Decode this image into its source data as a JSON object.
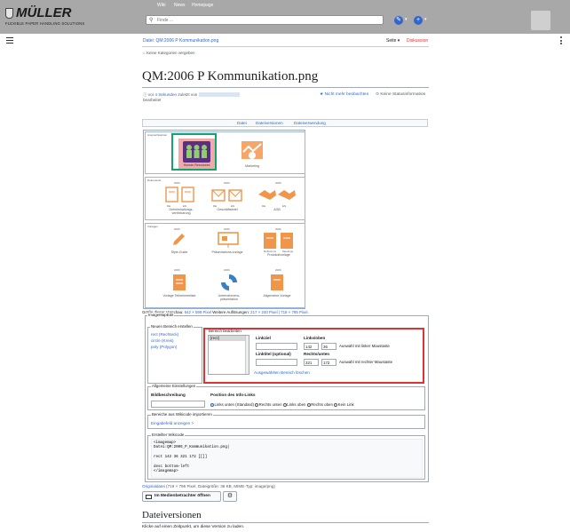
{
  "header": {
    "logo_text": "MÜLLER",
    "logo_sub": "FLEXIBLE PAPER HANDLING SOLUTIONS",
    "nav": [
      "Wiki",
      "News",
      "Homepage"
    ],
    "search_placeholder": "Finde ..."
  },
  "breadcrumb": "Datei: QM:2006 P Kommunikation.png",
  "page_tools": {
    "seite": "Seite ▾",
    "diskussion": "Diskussion"
  },
  "categories": "Keine Kategorien vergeben",
  "title": "QM:2006 P Kommunikation.png",
  "meta": {
    "edited_link": "vor 4 Sekunden",
    "edited_by": "zuletzt von",
    "edited_suffix": "bearbeitet",
    "watch": "Nicht mehr beobachten",
    "status": "Keine Statusinformation"
  },
  "file_tabs": [
    "Datei",
    "Dateiversionen",
    "Dateiverwendung"
  ],
  "map": {
    "groups": [
      {
        "label": "Ansprechpartner"
      },
      {
        "label": "Dokumente"
      },
      {
        "label": "Vorlagen"
      }
    ],
    "items": {
      "hr": "Human Resources",
      "marketing": "Marketing",
      "geheim": "Geheimhaltungs-vereinbarung",
      "brief": "Geschäftsbrief",
      "agb": "AGB",
      "style": "Style-Guide",
      "praes": "Präsentations-vorlage",
      "proto": "Protokollvorlage",
      "teil": "Vorlage Teilnehmerliste",
      "unter": "Unternehmens-präsentation",
      "allg": "Allgemeine Vorlage"
    },
    "years": [
      "2006",
      "2006",
      "2006",
      "2006",
      "2006",
      "2006",
      "2006",
      "2006"
    ],
    "sub_labels": [
      "DE",
      "EN",
      "DE",
      "EN",
      "DE",
      "EN",
      "Reflexions",
      "Meetings"
    ]
  },
  "preview_note": {
    "prefix": "Größe dieser Vorschau:",
    "size": "642 × 599 Pixel",
    "more": "Weitere Auflösungen:",
    "res": "217 × 240 Pixel | 719 × 795 Pixel."
  },
  "imagemap": {
    "legend": "ImageMapEdit",
    "new_area": {
      "legend": "Neuen Bereich erstellen",
      "options": [
        "rect (Rechteck)",
        "circle (Kreis)",
        "poly (Polygon)"
      ]
    },
    "edit_area": {
      "legend": "Bereich bearbeiten",
      "list_item": "[rect]",
      "linkziel": "Linkziel",
      "linktitel": "Linktitel (optional)",
      "links_oben": "Links/oben",
      "rechts_unten": "Rechts/unten",
      "lo_x": "142",
      "lo_y": "36",
      "ru_x": "321",
      "ru_y": "172",
      "hint_left": "Auswahl mit linker Maustaste",
      "hint_right": "Auswahl mit rechter Maustaste",
      "delete": "Ausgewählten Bereich löschen"
    },
    "general": {
      "legend": "Allgemeine Einstellungen",
      "bildbeschreibung": "Bildbeschreibung",
      "position": "Position des Info-Links",
      "radios": [
        "Links unten (Standard)",
        "Rechts unten",
        "Links oben",
        "Rechts oben",
        "Kein Link"
      ]
    },
    "import": {
      "legend": "Bereiche aus Wikicode importieren",
      "link": "Eingabefeld anzeigen >"
    },
    "wikicode": {
      "legend": "Erstellter Wikicode",
      "code": "<imagemap>\nDatei:QM:2006_P_Kommunikation.png|\n\nrect 142 36 321 172 [[]]\n\ndesc bottom-left\n</imagemap>"
    }
  },
  "original": {
    "link": "Originaldatei",
    "info": "(719 × 795 Pixel, Dateigröße: 36 KB, MIME-Typ: image/png)"
  },
  "viewer_button": "Im Medienbetrachter öffnen",
  "versions": {
    "heading": "Dateiversionen",
    "text": "Klicke auf einen Zeitpunkt, um diese Version zu laden."
  }
}
